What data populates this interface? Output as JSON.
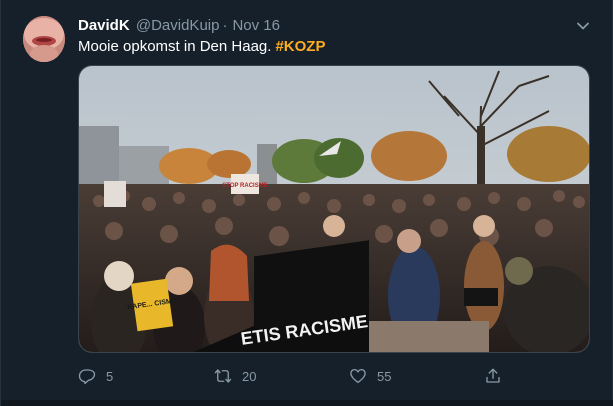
{
  "tweet": {
    "author_name": "DavidK",
    "author_handle": "@DavidKuip",
    "separator": "·",
    "date": "Nov 16",
    "text": "Mooie opkomst in Den Haag.",
    "hashtag": "#KOZP",
    "photo": {
      "banner_text": "ETIS RACISME",
      "sign_stop": "STOP RACISME",
      "sign_yellow": "KAPE... CISME"
    }
  },
  "actions": {
    "replies": "5",
    "retweets": "20",
    "likes": "55"
  },
  "icons": {
    "menu": "chevron-down-icon",
    "reply": "reply-icon",
    "retweet": "retweet-icon",
    "like": "heart-icon",
    "share": "share-icon"
  },
  "colors": {
    "background": "#15202b",
    "secondary_text": "#8899a6",
    "hashtag": "#ffad1f",
    "border": "#38444d"
  }
}
